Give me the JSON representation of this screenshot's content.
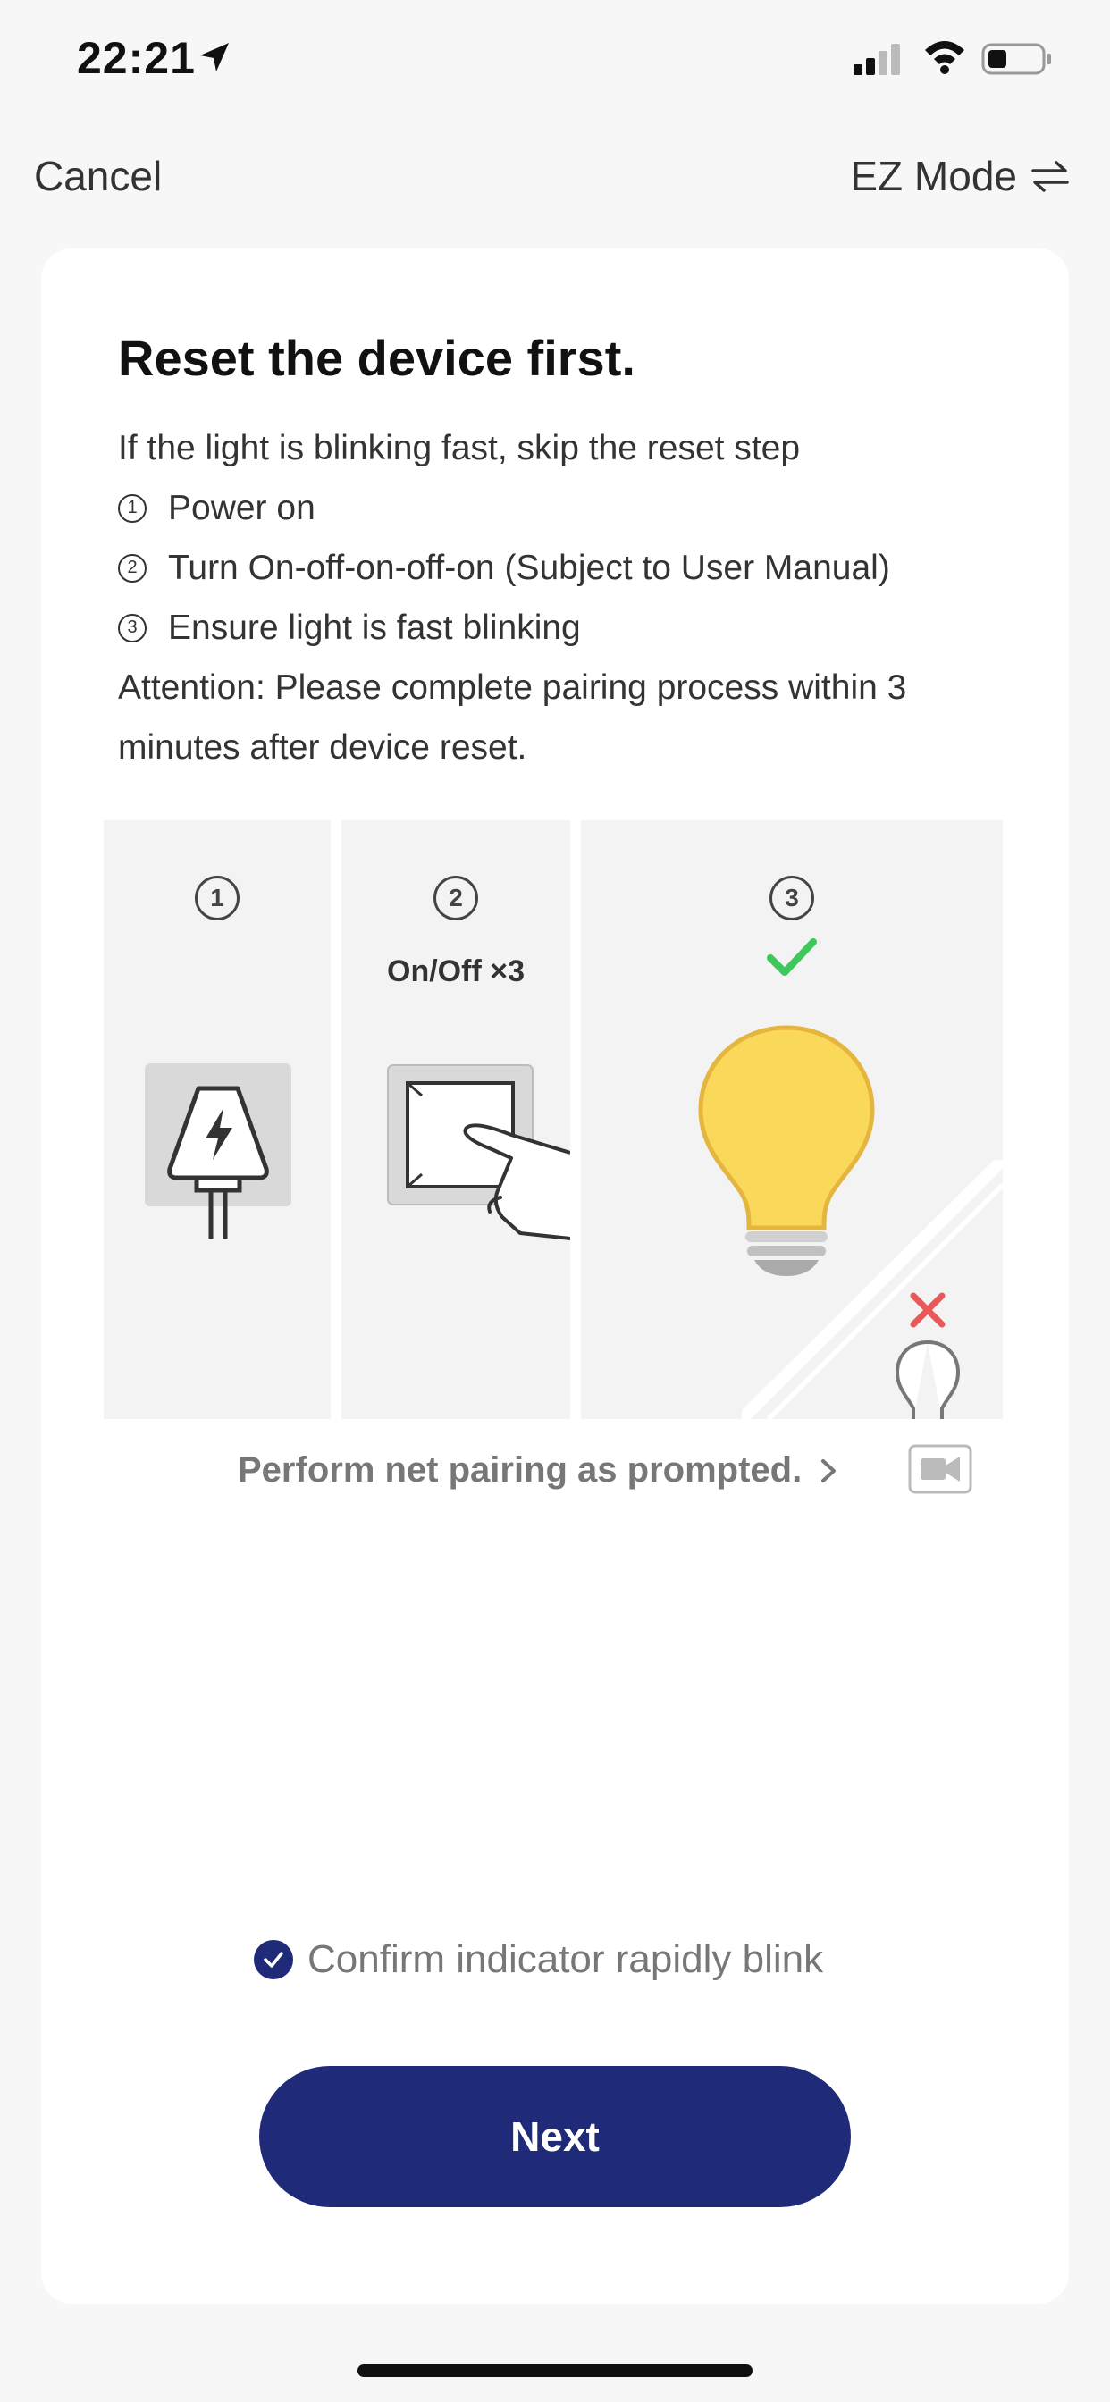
{
  "status_bar": {
    "time": "22:21"
  },
  "nav": {
    "cancel_label": "Cancel",
    "mode_label": "EZ Mode"
  },
  "card": {
    "title": "Reset the device first.",
    "intro": "If the light is blinking fast, skip the reset step",
    "steps": [
      {
        "num": "1",
        "text": "Power on"
      },
      {
        "num": "2",
        "text": "Turn On-off-on-off-on (Subject to User Manual)"
      },
      {
        "num": "3",
        "text": "Ensure light is fast blinking"
      }
    ],
    "attention_line1": "Attention: Please complete pairing process within 3",
    "attention_line2": "minutes after device reset.",
    "illustration": {
      "step_labels": [
        "1",
        "2",
        "3"
      ],
      "on_off_label": "On/Off ×3"
    },
    "prompt_link": "Perform net pairing as prompted.",
    "confirm_label": "Confirm indicator rapidly blink",
    "confirm_checked": true,
    "next_label": "Next"
  },
  "colors": {
    "accent": "#1f2a78",
    "bulb_yellow": "#f9d85a",
    "check_green": "#3cc85a",
    "cross_red": "#e85a5a"
  }
}
